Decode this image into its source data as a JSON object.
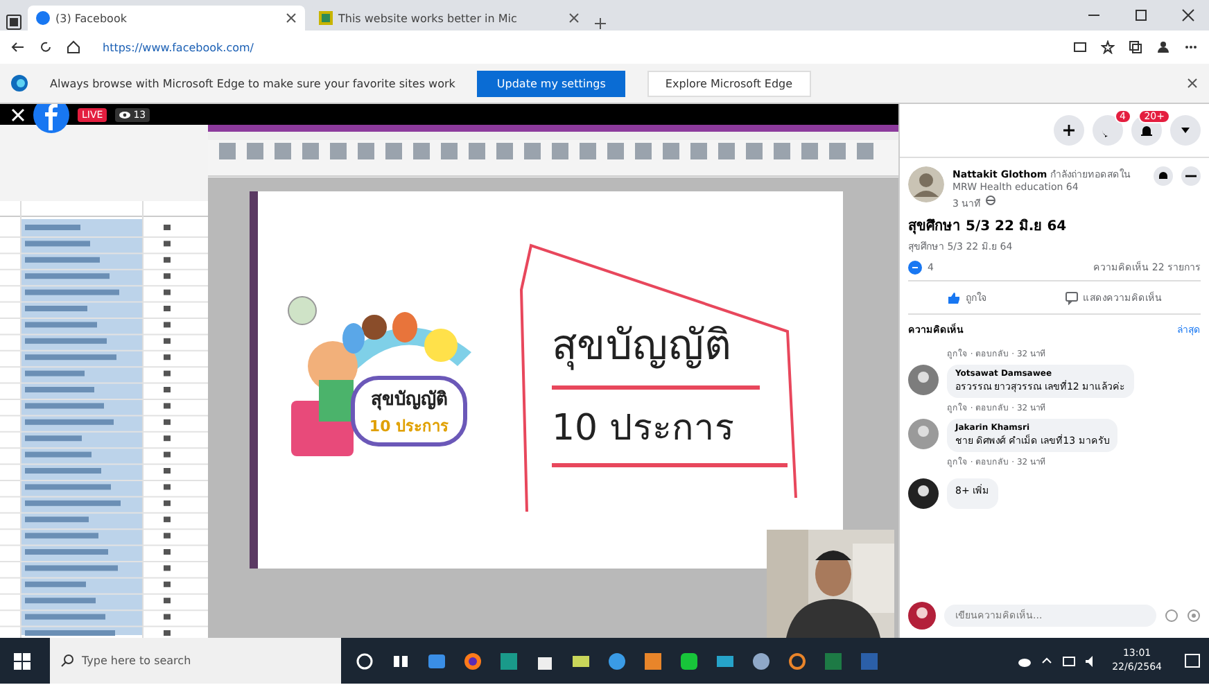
{
  "browser": {
    "tabs": [
      {
        "title": "(3) Facebook",
        "selected": true
      },
      {
        "title": "This website works better in Mic",
        "selected": false
      }
    ],
    "address": "https://www.facebook.com/",
    "infobar": {
      "message": "Always browse with Microsoft Edge to make sure your favorite sites work",
      "primary_button": "Update my settings",
      "secondary_button": "Explore Microsoft Edge"
    }
  },
  "video": {
    "live_badge": "LIVE",
    "viewers": "13",
    "slide": {
      "title": "สุขบัญญัติ",
      "subtitle": "10 ประการ",
      "cover_title": "สุขบัญญัติ",
      "cover_subtitle": "10 ประการ"
    }
  },
  "facebook": {
    "messenger_badge": "4",
    "notifications_badge": "20+",
    "post": {
      "author": "Nattakit Glothom",
      "context": "กำลังถ่ายทอดสดใน MRW Health education 64",
      "time": "3 นาที",
      "title": "สุขศึกษา 5/3 22 มิ.ย 64",
      "subtitle": "สุขศึกษา 5/3 22 มิ.ย 64",
      "reactions": "4",
      "comment_count": "ความคิดเห็น 22 รายการ"
    },
    "actions": [
      "ถูกใจ",
      "แสดงความคิดเห็น"
    ],
    "comments_heading": "ความคิดเห็น",
    "comments_sort": "ล่าสุด",
    "first_meta": "ถูกใจ · ตอบกลับ · 32 นาที",
    "comments": [
      {
        "name": "Yotsawat Damsawee",
        "text": "อรวรรณ ยาวสุวรรณ เลขที่12 มาแล้วค่ะ",
        "meta": "ถูกใจ · ตอบกลับ · 32 นาที"
      },
      {
        "name": "Jakarin Khamsri",
        "text": "ชาย ดิศพงศ์ คำเม็ด เลขที่13 มาครับ",
        "meta": "ถูกใจ · ตอบกลับ · 32 นาที"
      },
      {
        "text": "8+ เพิ่ม"
      }
    ],
    "comment_placeholder": "เขียนความคิดเห็น..."
  },
  "taskbar": {
    "search_placeholder": "Type here to search",
    "time": "13:01",
    "date": "22/6/2564"
  }
}
